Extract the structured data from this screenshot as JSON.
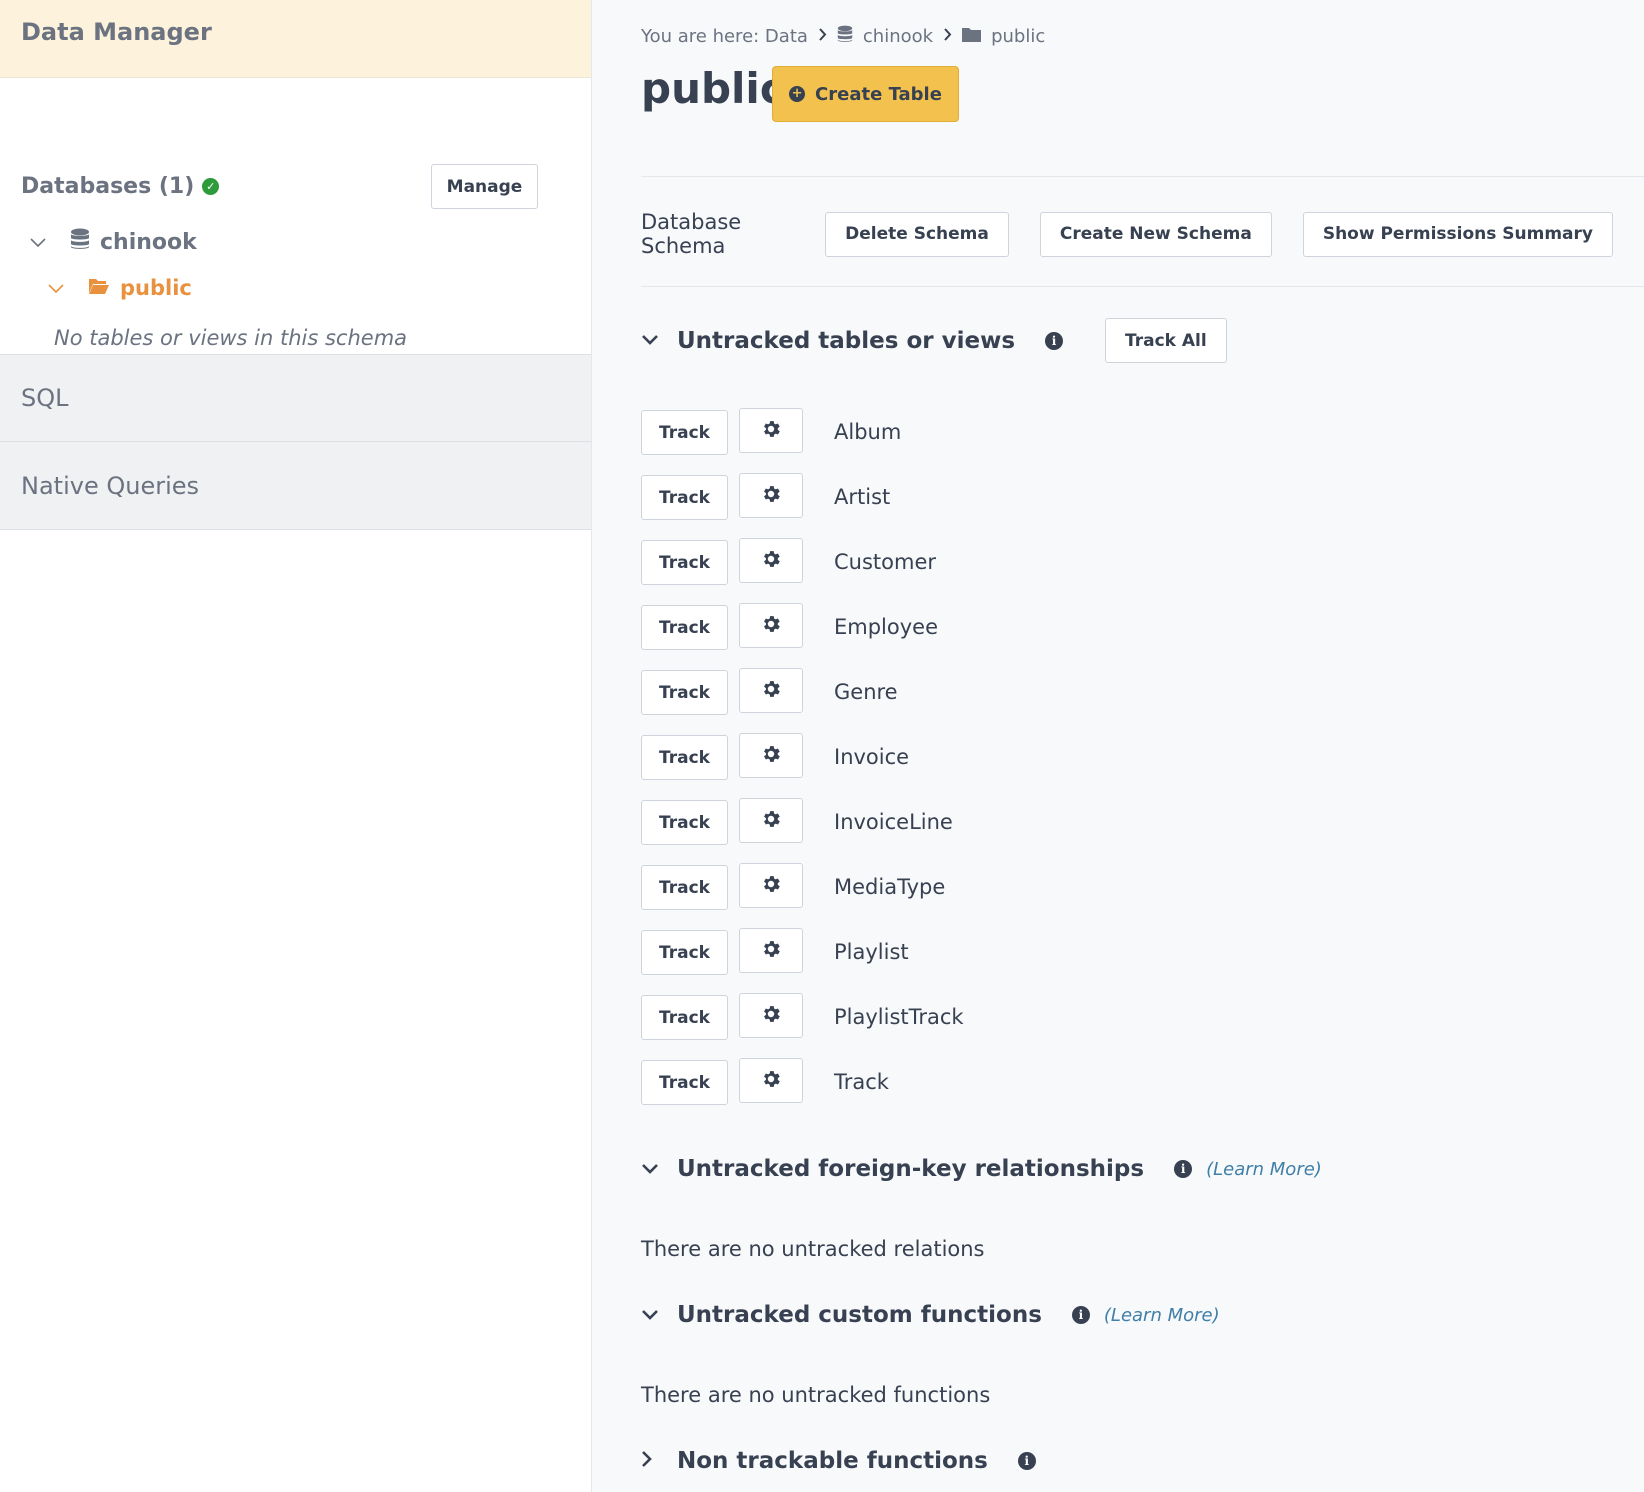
{
  "sidebar": {
    "title": "Data Manager",
    "databases_label": "Databases (1)",
    "manage_label": "Manage",
    "db_name": "chinook",
    "schema_name": "public",
    "empty_schema_note": "No tables or views in this schema",
    "sql_label": "SQL",
    "native_queries_label": "Native Queries"
  },
  "breadcrumb": {
    "prefix": "You are here: Data",
    "db": "chinook",
    "schema": "public"
  },
  "header": {
    "title": "public",
    "create_table_label": "Create Table"
  },
  "schema_bar": {
    "label": "Database Schema",
    "delete_label": "Delete Schema",
    "create_new_label": "Create New Schema",
    "permissions_label": "Show Permissions Summary"
  },
  "untracked_tables": {
    "title": "Untracked tables or views",
    "track_all_label": "Track All",
    "track_label": "Track",
    "tables": [
      "Album",
      "Artist",
      "Customer",
      "Employee",
      "Genre",
      "Invoice",
      "InvoiceLine",
      "MediaType",
      "Playlist",
      "PlaylistTrack",
      "Track"
    ]
  },
  "untracked_relationships": {
    "title": "Untracked foreign-key relationships",
    "learn_more": "(Learn More)",
    "empty_message": "There are no untracked relations"
  },
  "untracked_functions": {
    "title": "Untracked custom functions",
    "learn_more": "(Learn More)",
    "empty_message": "There are no untracked functions"
  },
  "non_trackable": {
    "title": "Non trackable functions"
  },
  "icons": {
    "status": "check-circle-icon",
    "database": "database-icon",
    "folder": "folder-icon",
    "folder_open": "folder-open-icon",
    "gear": "gear-icon",
    "info": "info-icon",
    "plus": "plus-circle-icon"
  },
  "colors": {
    "accent": "#f2c14e",
    "schema_active": "#e8923f",
    "status_ok": "#2e9b3a",
    "link": "#3f7fa8"
  }
}
